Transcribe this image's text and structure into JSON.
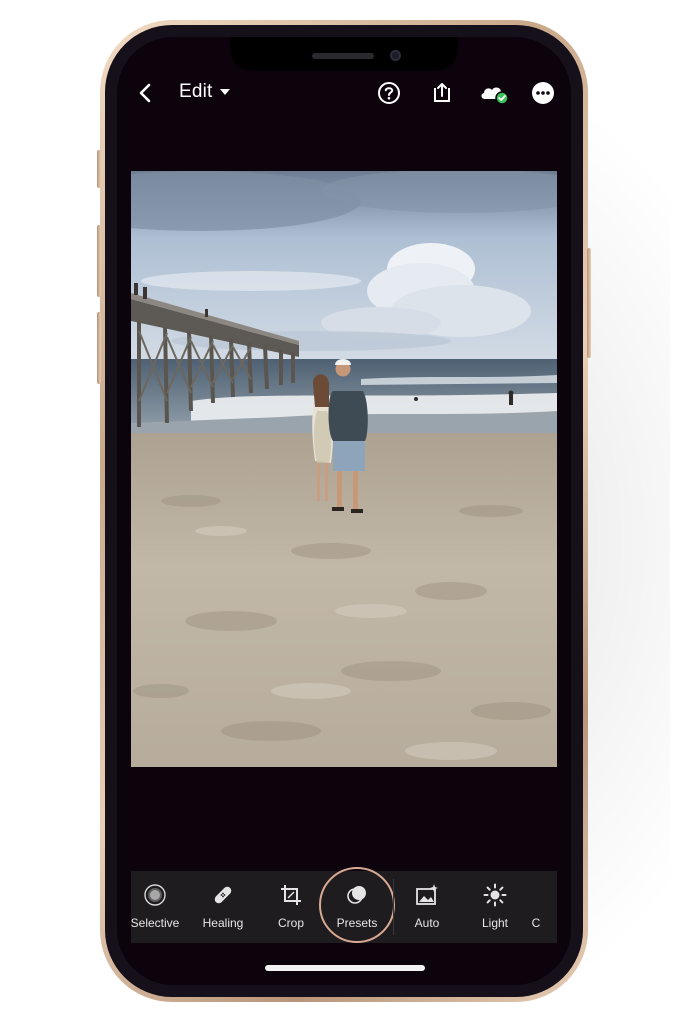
{
  "header": {
    "title": "Edit",
    "icons": [
      "back-chevron-icon",
      "help-icon",
      "share-icon",
      "cloud-synced-icon",
      "more-icon"
    ]
  },
  "toolbar": {
    "selected": "Presets",
    "items": [
      {
        "label": "Selective",
        "icon": "selective-icon"
      },
      {
        "label": "Healing",
        "icon": "healing-bandage-icon"
      },
      {
        "label": "Crop",
        "icon": "crop-icon"
      },
      {
        "label": "Presets",
        "icon": "presets-icon"
      },
      {
        "label": "Auto",
        "icon": "auto-icon"
      },
      {
        "label": "Light",
        "icon": "light-sun-icon"
      },
      {
        "label": "C",
        "icon": "partial-icon"
      }
    ]
  },
  "colors": {
    "background": "#0c030c",
    "toolbar": "#1e1c1e",
    "accent_ring": "#d9a994",
    "sync_ok": "#3cc05a"
  }
}
